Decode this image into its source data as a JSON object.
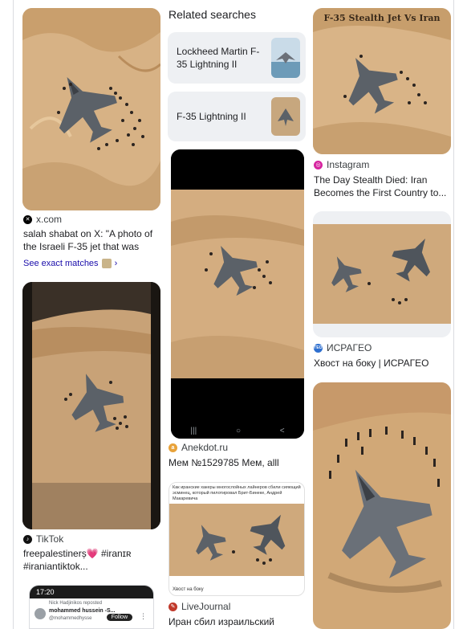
{
  "related": {
    "heading": "Related searches",
    "chips": [
      {
        "label": "Lockheed Martin F-35 Lightning II"
      },
      {
        "label": "F-35 Lightning II"
      }
    ]
  },
  "cards": {
    "c1": {
      "source": "x.com",
      "title": "salah shabat on X: \"A photo of the Israeli F-35 jet that was sh...",
      "favicon_color": "#000000"
    },
    "see_exact": "See exact matches",
    "c2": {
      "source": "TikTok",
      "title": "freepalestinerș💗 #iranɪʀ #iraniantiktok...",
      "favicon_color": "#111111"
    },
    "c2_phone": {
      "time": "17:20",
      "name": "Nick Hadjinikos reposted",
      "handle": "mohammed hussein -S...",
      "user": "@mohammedhysse",
      "follow": "Follow"
    },
    "c3": {
      "source": "Anekdot.ru",
      "title": "Мем №1529785 Мем, alll",
      "favicon_color": "#e8a23a"
    },
    "c4": {
      "source": "LiveJournal",
      "title": "Иран сбил израильский",
      "favicon_color": "#c0392b"
    },
    "c4_caption": "Как иранские хакеры многослойных лайнеров сбили сияющий эсминец, который пилотировал Брит-Бинеке, Андрей Макаревича",
    "c4_foot": "Хвост на боку",
    "c5": {
      "source": "Instagram",
      "title": "The Day Stealth Died: Iran Becomes the First Country to...",
      "favicon_color": "#d6249f",
      "overlay": "F-35 Stealth Jet Vs Iran"
    },
    "c6": {
      "source": "ИСРАГЕО",
      "title": "Хвост на боку | ИСРАГЕО",
      "favicon_color": "#2e6fcf",
      "favicon_text": "ГЕО"
    },
    "phone_nav": [
      "|||",
      "○",
      "<"
    ]
  },
  "colors": {
    "sand": "#d9b487",
    "sand_dark": "#b98d5c",
    "jet": "#5b6168",
    "link": "#1a0dab"
  }
}
